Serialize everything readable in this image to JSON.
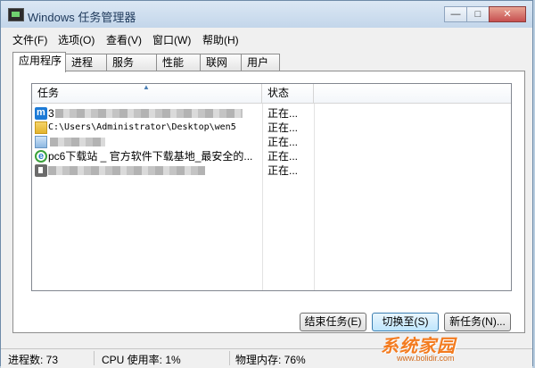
{
  "window": {
    "title": "Windows 任务管理器"
  },
  "titlebar_buttons": {
    "minimize": "—",
    "maximize": "□",
    "close": "✕"
  },
  "menu": [
    "文件(F)",
    "选项(O)",
    "查看(V)",
    "窗口(W)",
    "帮助(H)"
  ],
  "tabs": [
    "应用程序",
    "进程",
    "服务",
    "性能",
    "联网",
    "用户"
  ],
  "active_tab": "应用程序",
  "list": {
    "columns": [
      "任务",
      "状态"
    ],
    "rows": [
      {
        "icon": "m-app-icon",
        "name": "3",
        "status": "正在..."
      },
      {
        "icon": "folder-icon",
        "name": "C:\\Users\\Administrator\\Desktop\\wen5",
        "status": "正在..."
      },
      {
        "icon": "folder-icon",
        "name": "",
        "status": "正在..."
      },
      {
        "icon": "ie-icon",
        "name": "pc6下载站 _ 官方软件下载基地_最安全的...",
        "status": "正在..."
      },
      {
        "icon": "pen-icon",
        "name": "",
        "status": "正在..."
      }
    ]
  },
  "buttons": {
    "end_task": "结束任务(E)",
    "switch_to": "切换至(S)",
    "new_task": "新任务(N)..."
  },
  "statusbar": {
    "processes": "进程数: 73",
    "cpu": "CPU 使用率: 1%",
    "memory": "物理内存: 76%"
  },
  "watermark": {
    "text": "系统家园",
    "url": "www.bolidir.com"
  }
}
